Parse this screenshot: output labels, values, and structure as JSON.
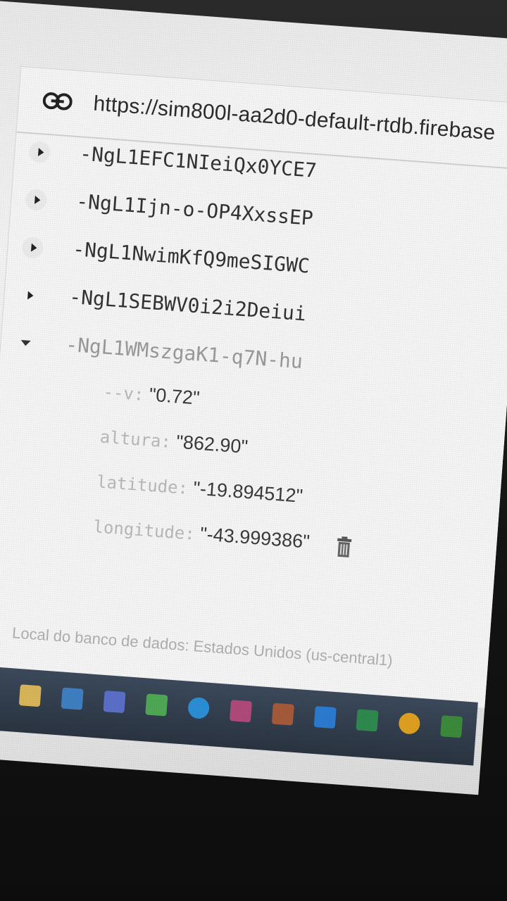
{
  "url_bar": {
    "url": "https://sim800l-aa2d0-default-rtdb.firebase"
  },
  "tree": {
    "nodes": [
      {
        "key": "-NgL1EFC1NIeiQx0YCE7",
        "expanded": false
      },
      {
        "key": "-NgL1Ijn-o-OP4XxssEP",
        "expanded": false
      },
      {
        "key": "-NgL1NwimKfQ9meSIGWC",
        "expanded": false
      },
      {
        "key": "-NgL1SEBWV0i2i2Deiui",
        "expanded": false
      },
      {
        "key": "-NgL1WMszgaK1-q7N-hu",
        "expanded": true
      }
    ],
    "children": [
      {
        "key": "--v:",
        "value": "\"0.72\""
      },
      {
        "key": "altura:",
        "value": "\"862.90\""
      },
      {
        "key": "latitude:",
        "value": "\"-19.894512\""
      },
      {
        "key": "longitude:",
        "value": "\"-43.999386\""
      }
    ]
  },
  "footer": {
    "text": "Local do banco de dados: Estados Unidos (us-central1)"
  },
  "icons": {
    "link": "link-icon",
    "trash": "trash-icon",
    "pin": "location-pin-icon"
  }
}
